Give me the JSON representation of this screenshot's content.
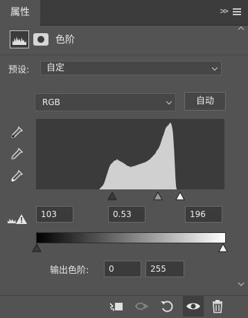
{
  "tab": {
    "label": "属性"
  },
  "panel_menu": {
    "collapse_label": ">>"
  },
  "header": {
    "title": "色阶",
    "icons": [
      "levels-adjustment-icon",
      "layer-mask-icon"
    ]
  },
  "preset": {
    "label": "预设:",
    "value": "自定"
  },
  "channel": {
    "value": "RGB",
    "auto_label": "自动"
  },
  "eyedroppers": [
    "black-point-eyedropper-icon",
    "gray-point-eyedropper-icon",
    "white-point-eyedropper-icon"
  ],
  "input_levels": {
    "black": "103",
    "gamma": "0.53",
    "white": "196"
  },
  "output_levels": {
    "label": "输出色阶:",
    "black": "0",
    "white": "255"
  },
  "histogram": {
    "fill_color": "#d0d0d0",
    "bg_color": "#3b3b3b",
    "values": [
      0,
      0,
      0,
      0,
      0,
      0,
      0,
      0,
      0,
      0,
      0,
      0,
      0,
      0,
      0,
      0,
      0,
      0,
      0,
      0,
      0,
      0,
      0,
      0,
      0,
      0,
      0,
      0,
      0,
      0,
      0,
      0,
      0,
      0,
      0,
      0,
      0,
      0,
      0,
      0,
      0,
      0,
      0,
      0,
      0,
      0,
      0,
      0,
      0,
      0,
      0,
      0,
      0,
      0,
      0,
      0,
      0,
      0,
      0,
      0,
      0,
      0,
      0,
      0,
      0,
      0,
      0,
      0,
      0,
      0,
      0,
      0,
      0,
      0,
      0,
      0,
      0,
      0,
      0,
      0,
      0,
      0,
      0,
      0,
      0,
      0,
      0,
      0,
      0,
      0,
      0,
      0,
      0,
      0,
      0,
      1,
      2,
      3,
      4,
      5,
      6,
      8,
      10,
      13,
      16,
      19,
      22,
      25,
      28,
      31,
      33,
      35,
      36,
      37,
      38,
      39,
      40,
      41,
      41,
      41,
      42,
      43,
      42,
      41,
      41,
      40,
      40,
      39,
      39,
      38,
      38,
      37,
      36,
      36,
      35,
      34,
      34,
      33,
      33,
      33,
      32,
      32,
      32,
      32,
      33,
      33,
      33,
      33,
      34,
      34,
      34,
      35,
      35,
      35,
      36,
      36,
      36,
      37,
      37,
      37,
      38,
      38,
      38,
      39,
      39,
      40,
      40,
      41,
      42,
      42,
      43,
      44,
      45,
      46,
      47,
      48,
      49,
      50,
      51,
      53,
      55,
      56,
      57,
      59,
      61,
      63,
      66,
      69,
      72,
      75,
      77,
      80,
      83,
      86,
      88,
      89,
      90,
      91,
      92,
      93,
      95,
      94,
      92,
      88,
      82,
      70,
      55,
      35,
      15,
      3,
      0,
      0,
      0,
      0,
      0,
      0,
      0,
      0,
      0,
      0,
      0,
      0,
      0,
      0,
      0,
      0,
      0,
      0,
      0,
      0,
      0,
      0,
      0,
      0,
      0,
      0,
      0,
      0,
      0,
      0,
      0,
      0,
      0,
      0,
      0,
      0,
      0,
      0,
      0,
      0,
      0,
      0,
      0,
      0,
      0,
      0,
      0,
      0,
      0,
      0,
      0,
      0,
      0,
      0,
      0,
      0,
      0,
      0,
      0,
      0,
      0,
      0,
      0,
      0,
      0,
      0,
      0,
      0,
      0,
      0,
      0,
      0
    ]
  },
  "bottom_toolbar": [
    "clip-to-layer-icon",
    "view-previous-state-icon",
    "reset-icon",
    "toggle-visibility-icon",
    "delete-icon"
  ]
}
